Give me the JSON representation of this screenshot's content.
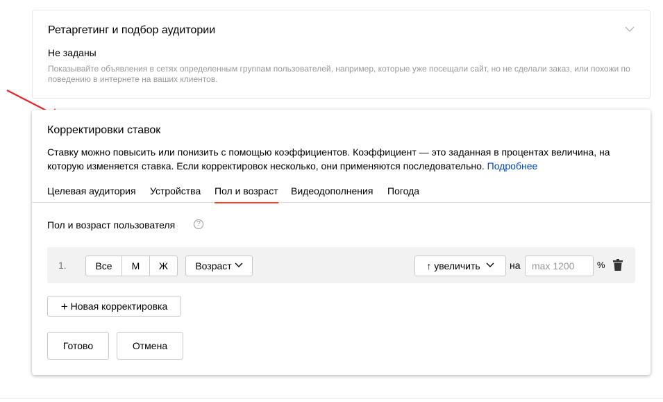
{
  "retargeting": {
    "title": "Ретаргетинг и подбор аудитории",
    "value": "Не заданы",
    "hint": "Показывайте объявления в сетях определенным группам пользователей, например, которые уже посещали сайт, но не сделали заказ, или похожи по поведению в интернете на ваших клиентов."
  },
  "adjustments": {
    "title": "Корректировки ставок",
    "description": "Ставку можно повысить или понизить с помощью коэффициентов. Коэффициент — это заданная в процентах величина, на которую изменяется ставка. Если корректировок несколько, они применяются последовательно.",
    "more_link": "Подробнее",
    "tabs": [
      {
        "label": "Целевая аудитория",
        "active": false
      },
      {
        "label": "Устройства",
        "active": false
      },
      {
        "label": "Пол и возраст",
        "active": true
      },
      {
        "label": "Видеодополнения",
        "active": false
      },
      {
        "label": "Погода",
        "active": false
      }
    ],
    "section_title": "Пол и возраст пользователя",
    "help_icon": "?",
    "row": {
      "number": "1.",
      "gender_options": [
        "Все",
        "М",
        "Ж"
      ],
      "age_dropdown": "Возраст",
      "direction_dropdown": "↑ увеличить",
      "on_label": "на",
      "value_placeholder": "max 1200",
      "percent_sign": "%"
    },
    "add_button": "Новая корректировка",
    "ok_button": "Готово",
    "cancel_button": "Отмена"
  },
  "colors": {
    "accent_tab": "#fc3f1d",
    "link": "#0044bb",
    "annotation_arrow": "#e8242a"
  }
}
